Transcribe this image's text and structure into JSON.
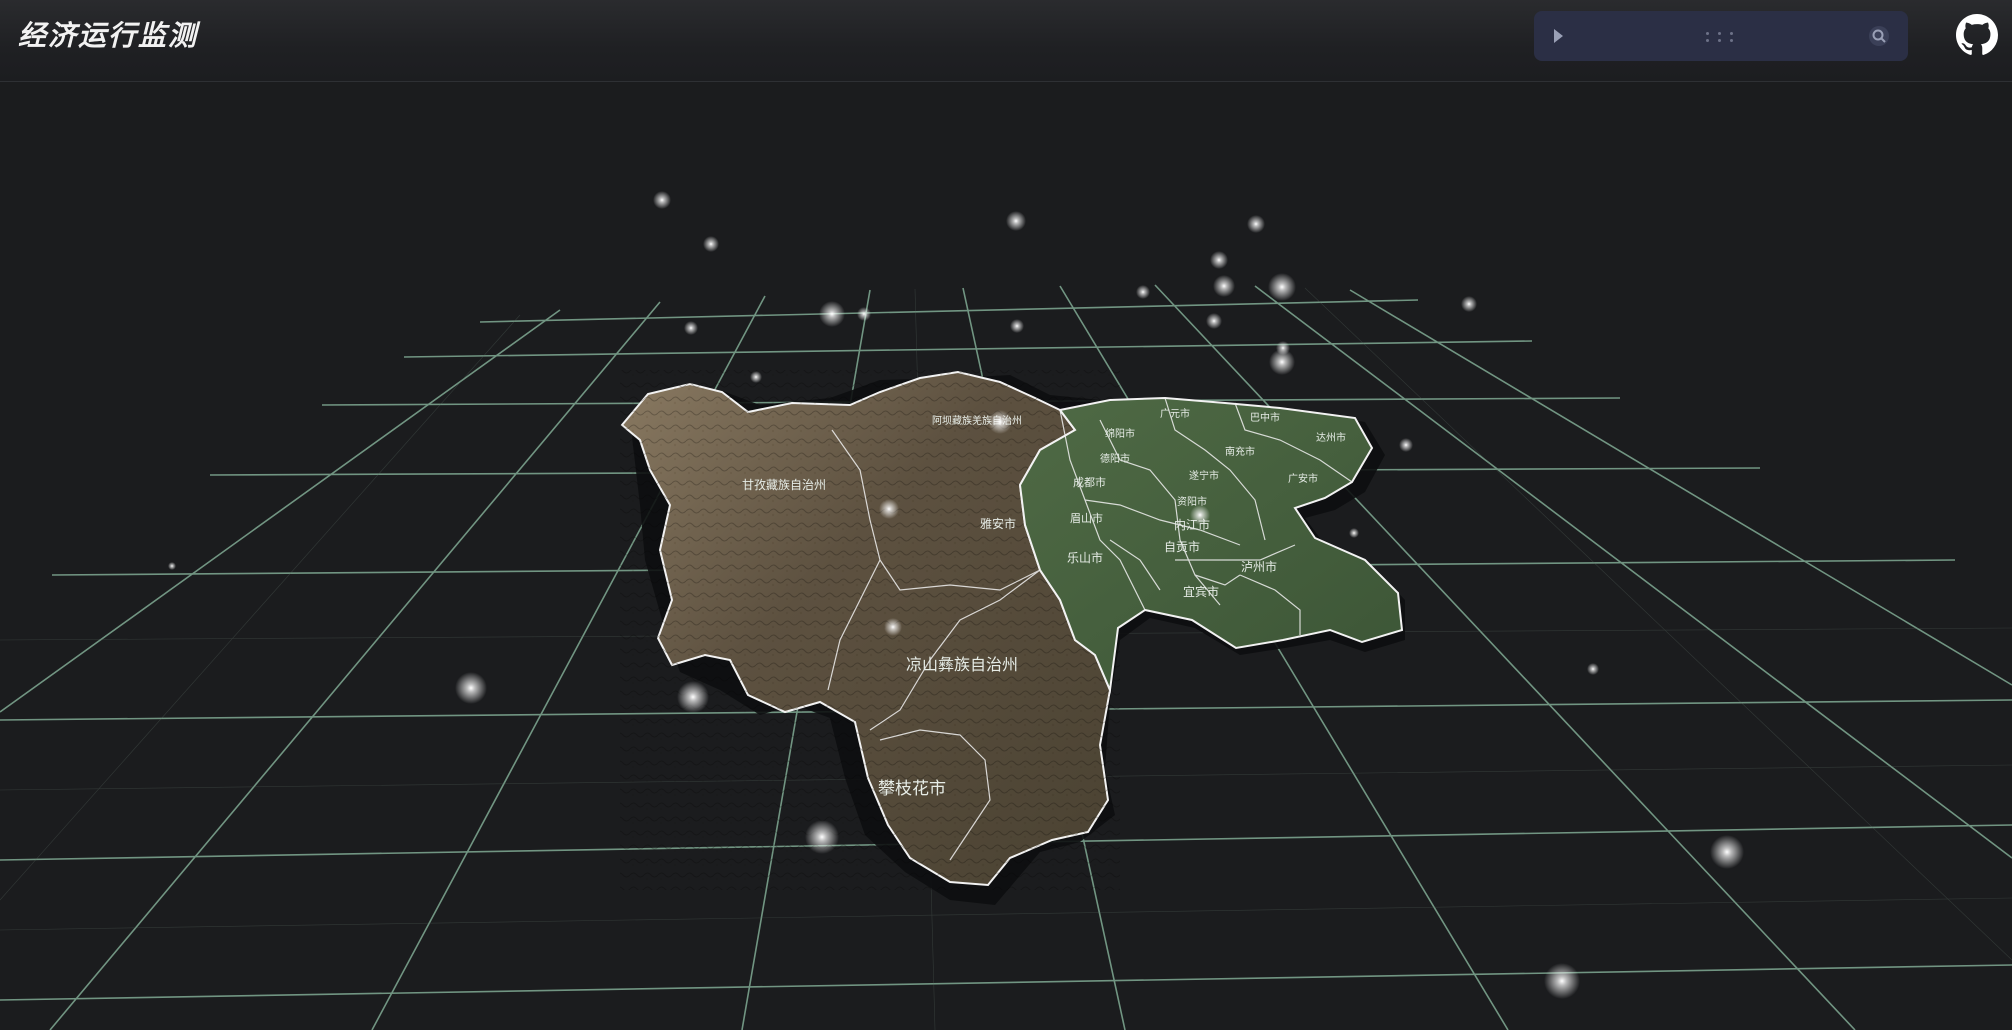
{
  "header": {
    "title": "经济运行监测"
  },
  "icons": {
    "play": "play-icon",
    "drag": "drag-handle-icon",
    "zoom": "zoom-icon",
    "github": "github-icon"
  },
  "map": {
    "region_labels": {
      "ganzi": "甘孜藏族自治州",
      "aba": "阿坝藏族羌族自治州",
      "liangshan": "凉山彝族自治州",
      "panzhihua": "攀枝花市",
      "yaan": "雅安市",
      "chengdu": "成都市",
      "meishan": "眉山市",
      "leshan": "乐山市",
      "neijiang": "内江市",
      "zigong": "自贡市",
      "luzhou": "泸州市",
      "yibin": "宜宾市",
      "mianyang": "绵阳市",
      "deyang": "德阳市",
      "suining": "遂宁市",
      "ziyang": "资阳市",
      "nanchong": "南充市",
      "guangyuan": "广元市",
      "bazhong": "巴中市",
      "dazhou": "达州市",
      "guangan": "广安市"
    }
  },
  "colors": {
    "background": "#1b1c1e",
    "grid": "#9fd6b8",
    "player_bg": "#2b2f45",
    "label": "#e6ece6"
  }
}
